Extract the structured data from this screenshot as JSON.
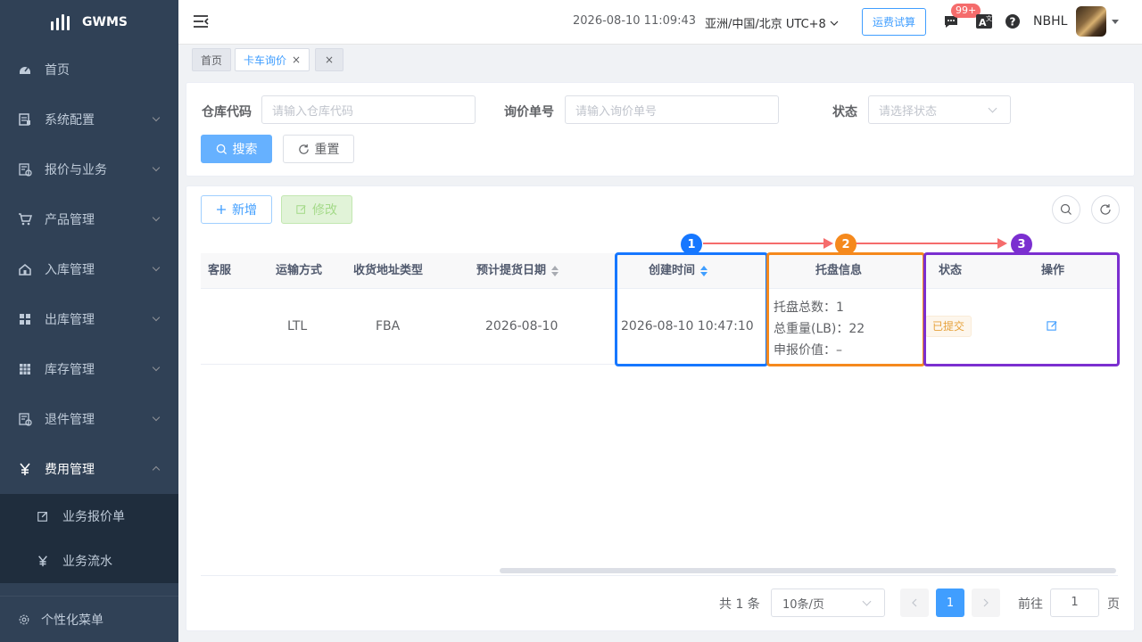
{
  "app": {
    "logo_text": "GWMS"
  },
  "sidebar": {
    "items": [
      {
        "label": "首页",
        "icon": "dashboard-icon"
      },
      {
        "label": "系统配置",
        "icon": "system-icon"
      },
      {
        "label": "报价与业务",
        "icon": "quote-icon"
      },
      {
        "label": "产品管理",
        "icon": "cart-icon"
      },
      {
        "label": "入库管理",
        "icon": "home-icon"
      },
      {
        "label": "出库管理",
        "icon": "grid-icon"
      },
      {
        "label": "库存管理",
        "icon": "table-icon"
      },
      {
        "label": "退件管理",
        "icon": "return-icon"
      },
      {
        "label": "费用管理",
        "icon": "yen-icon"
      }
    ],
    "sub_items": [
      {
        "label": "业务报价单",
        "icon": "edit-icon"
      },
      {
        "label": "业务流水",
        "icon": "yen-icon"
      }
    ],
    "custom_menu": "个性化菜单"
  },
  "header": {
    "datetime": "2026-08-10 11:09:43",
    "timezone": "亚洲/中国/北京 UTC+8",
    "freight_button": "运费试算",
    "badge": "99+",
    "username": "NBHL"
  },
  "tags": {
    "home": "首页",
    "current": "卡车询价",
    "close_all": "×"
  },
  "search": {
    "warehouse_label": "仓库代码",
    "warehouse_placeholder": "请输入仓库代码",
    "inquiry_label": "询价单号",
    "inquiry_placeholder": "请输入询价单号",
    "status_label": "状态",
    "status_placeholder": "请选择状态",
    "search_button": "搜索",
    "reset_button": "重置"
  },
  "toolbar": {
    "add_button": "新增",
    "edit_button": "修改"
  },
  "table": {
    "columns": {
      "service": "客服",
      "transport": "运输方式",
      "address_type": "收货地址类型",
      "pickup_date": "预计提货日期",
      "created": "创建时间",
      "pallet": "托盘信息",
      "status": "状态",
      "action": "操作"
    },
    "rows": [
      {
        "service": "",
        "transport": "LTL",
        "address_type": "FBA",
        "pickup_date": "2026-08-10",
        "created": "2026-08-10 10:47:10",
        "pallet_total": "托盘总数：1",
        "pallet_weight": "总重量(LB)：22",
        "pallet_value": "申报价值：–",
        "status": "已提交"
      }
    ]
  },
  "pagination": {
    "total": "共 1 条",
    "page_size": "10条/页",
    "current_page": "1",
    "goto_label": "前往",
    "goto_value": "1",
    "page_suffix": "页"
  },
  "annotations": [
    {
      "number": "1",
      "color": "#1677ff"
    },
    {
      "number": "2",
      "color": "#f5891d"
    },
    {
      "number": "3",
      "color": "#7b2fd0"
    }
  ],
  "colors": {
    "sidebar_bg": "#304156",
    "primary": "#409eff",
    "arrow": "#f56c6c"
  }
}
